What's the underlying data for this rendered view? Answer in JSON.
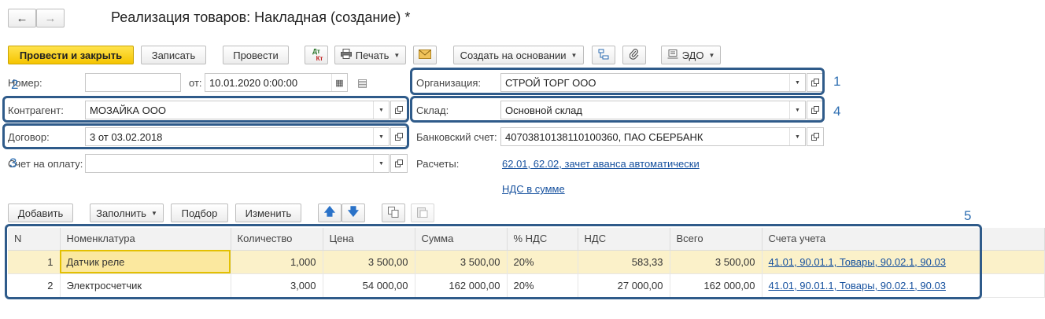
{
  "window": {
    "title": "Реализация товаров: Накладная (создание) *"
  },
  "toolbar": {
    "post_close": "Провести и закрыть",
    "save": "Записать",
    "post": "Провести",
    "dtkt_top": "Дт",
    "dtkt_bottom": "Кт",
    "print": "Печать",
    "create_based": "Создать на основании",
    "edo": "ЭДО"
  },
  "form": {
    "number_label": "Номер:",
    "date_label": "от:",
    "date_value": "10.01.2020  0:00:00",
    "org_label": "Организация:",
    "org_value": "СТРОЙ ТОРГ ООО",
    "contractor_label": "Контрагент:",
    "contractor_value": "МОЗАЙКА ООО",
    "warehouse_label": "Склад:",
    "warehouse_value": "Основной склад",
    "contract_label": "Договор:",
    "contract_value": "3 от 03.02.2018",
    "bank_label": "Банковский счет:",
    "bank_value": "40703810138110100360, ПАО СБЕРБАНК",
    "invoice_label": "Счет на оплату:",
    "settlements_label": "Расчеты:",
    "settlements_link": "62.01, 62.02, зачет аванса автоматически",
    "vat_link": "НДС в сумме"
  },
  "table_toolbar": {
    "add": "Добавить",
    "fill": "Заполнить",
    "pick": "Подбор",
    "change": "Изменить"
  },
  "table": {
    "columns": [
      "N",
      "Номенклатура",
      "Количество",
      "Цена",
      "Сумма",
      "% НДС",
      "НДС",
      "Всего",
      "Счета учета"
    ],
    "rows": [
      [
        "1",
        "Датчик реле",
        "1,000",
        "3 500,00",
        "3 500,00",
        "20%",
        "583,33",
        "3 500,00",
        "41.01, 90.01.1, Товары, 90.02.1, 90.03"
      ],
      [
        "2",
        "Электросчетчик",
        "3,000",
        "54 000,00",
        "162 000,00",
        "20%",
        "27 000,00",
        "162 000,00",
        "41.01, 90.01.1, Товары, 90.02.1, 90.03"
      ]
    ]
  },
  "annotations": {
    "n1": "1",
    "n2": "2",
    "n3": "3",
    "n4": "4",
    "n5": "5"
  },
  "colors": {
    "accent_yellow": "#f5c400",
    "highlight_blue": "#2f5b8a",
    "link": "#15509e",
    "selected_row": "#fbf1c9"
  }
}
